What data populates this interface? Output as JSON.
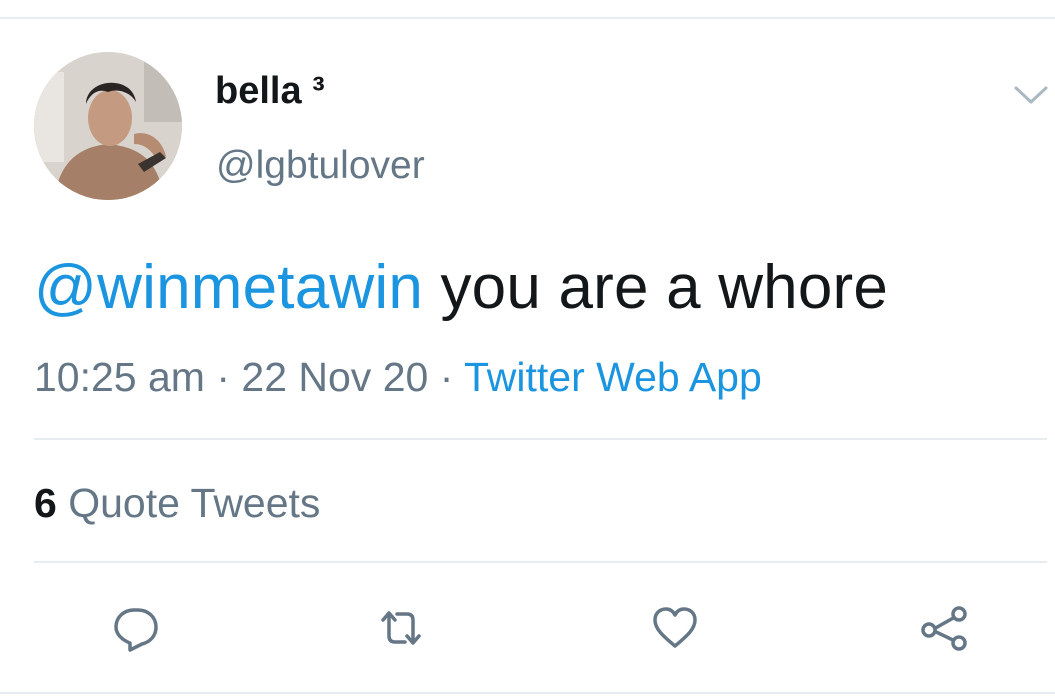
{
  "tweet": {
    "author": {
      "display_name": "bella ³",
      "handle": "@lgbtulover",
      "avatar_icon": "profile-photo"
    },
    "text": {
      "mention": "@winmetawin",
      "body": " you are a whore"
    },
    "meta": {
      "time": "10:25 am",
      "separator_1": " · ",
      "date": "22 Nov 20",
      "separator_2": " · ",
      "source": "Twitter Web App"
    },
    "stats": {
      "quote_count": "6",
      "quote_label": " Quote Tweets"
    },
    "actions": {
      "reply_icon": "reply-icon",
      "retweet_icon": "retweet-icon",
      "like_icon": "like-icon",
      "share_icon": "share-icon"
    },
    "menu_icon": "chevron-down-icon"
  },
  "colors": {
    "accent": "#1b95e0",
    "text_primary": "#14171a",
    "text_secondary": "#657786",
    "divider": "#e6ecf0"
  }
}
